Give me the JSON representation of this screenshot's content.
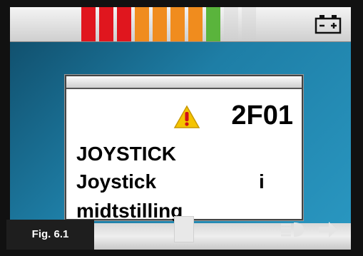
{
  "battery": {
    "segments": [
      {
        "color": "#e0161e",
        "state": "on"
      },
      {
        "color": "#e0161e",
        "state": "on"
      },
      {
        "color": "#e0161e",
        "state": "on"
      },
      {
        "color": "#f08c1e",
        "state": "on"
      },
      {
        "color": "#f08c1e",
        "state": "on"
      },
      {
        "color": "#f08c1e",
        "state": "on"
      },
      {
        "color": "#f08c1e",
        "state": "on"
      },
      {
        "color": "#5ab43c",
        "state": "on"
      },
      {
        "color": "#d9d9d9",
        "state": "off"
      },
      {
        "color": "#d9d9d9",
        "state": "off"
      }
    ],
    "icon": "battery-icon"
  },
  "dialog": {
    "icon": "warning-icon",
    "code": "2F01",
    "line1": "JOYSTICK",
    "line2": "Joystick",
    "line2_suffix": "i",
    "line3": "midtstilling"
  },
  "footer": {
    "figure_label": "Fig. 6.1",
    "icons": [
      "headlight-icon",
      "arrow-right-icon"
    ]
  },
  "colors": {
    "background_gradient": [
      "#0f4a66",
      "#2a98c2"
    ],
    "dialog_bg": "#ffffff",
    "fig_label_bg": "#1e1e1e"
  }
}
